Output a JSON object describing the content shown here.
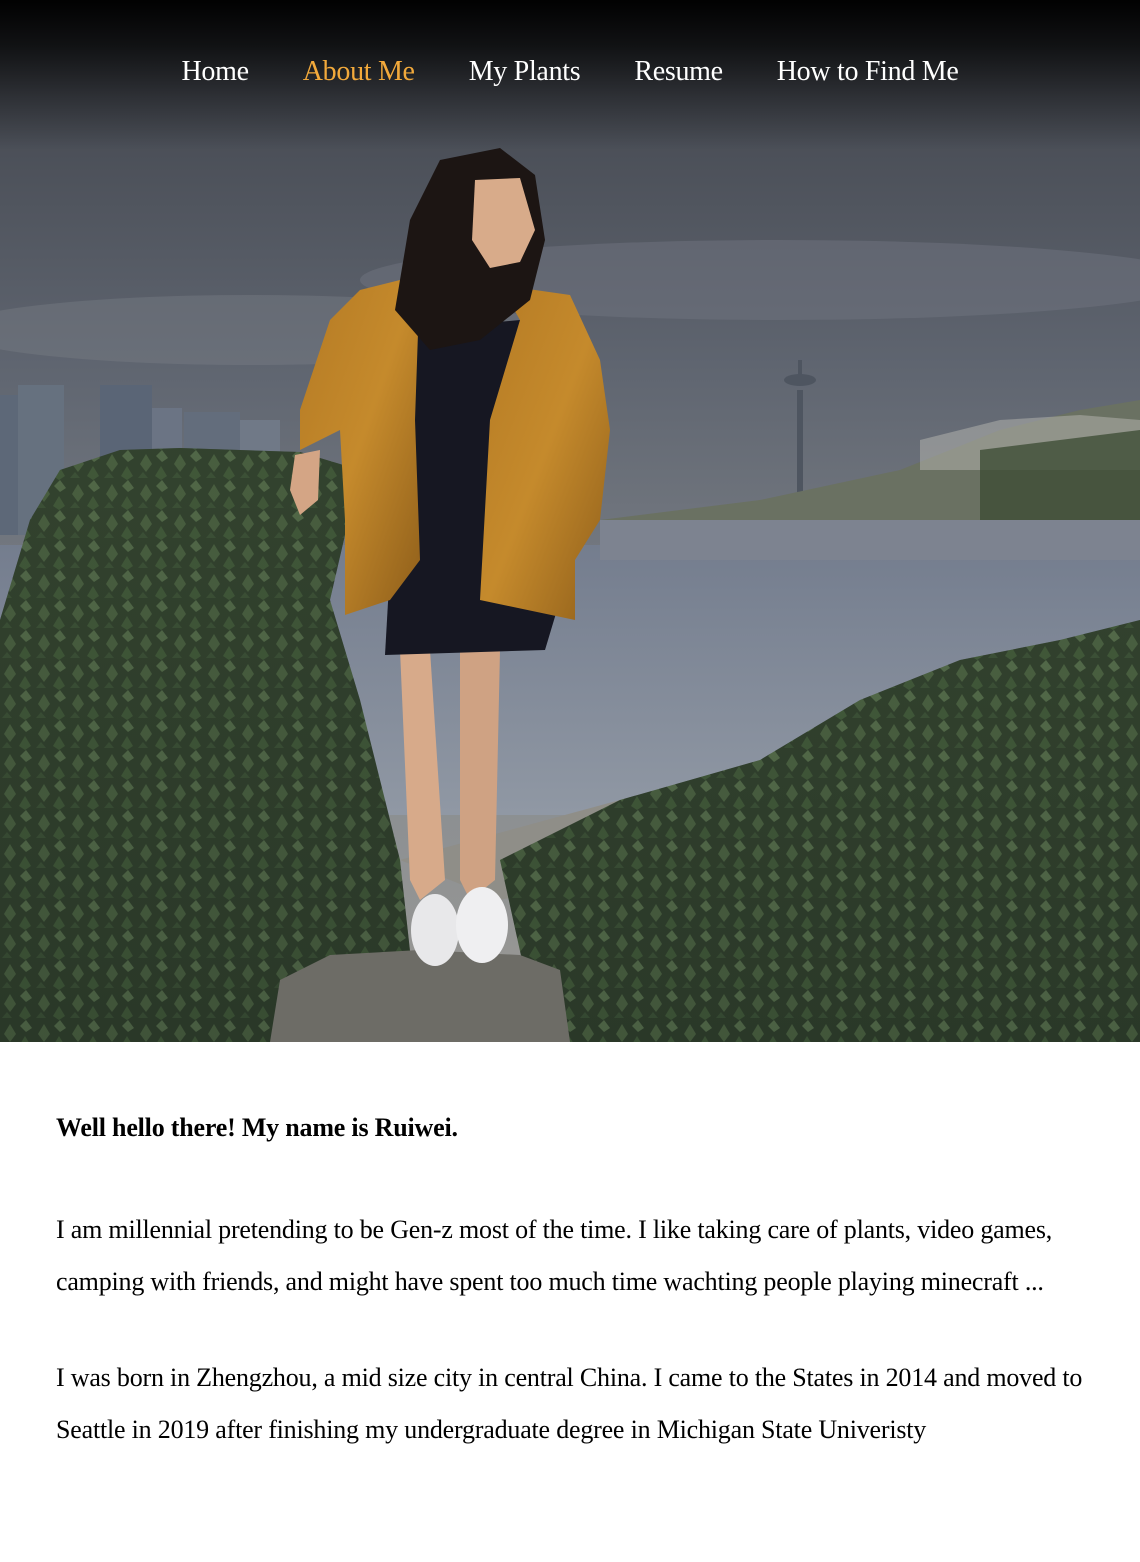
{
  "nav": {
    "items": [
      {
        "label": "Home",
        "active": false
      },
      {
        "label": "About Me",
        "active": true
      },
      {
        "label": "My Plants",
        "active": false
      },
      {
        "label": "Resume",
        "active": false
      },
      {
        "label": "How to Find Me",
        "active": false
      }
    ],
    "active_color": "#f2a93b"
  },
  "hero": {
    "scene": "woman-in-yellow-jacket-by-waterfront-with-city-skyline-and-ivy"
  },
  "about": {
    "heading": "Well hello there! My name is Ruiwei.",
    "paragraph_1": "I am millennial pretending to be Gen-z most of the time. I like taking care of plants, video games, camping with friends, and might have spent too much time wachting people playing minecraft ...",
    "paragraph_2": "I was born in Zhengzhou, a mid size city in central China. I came to the States in 2014 and moved to Seattle in 2019 after finishing my undergraduate degree in Michigan State Univeristy"
  }
}
